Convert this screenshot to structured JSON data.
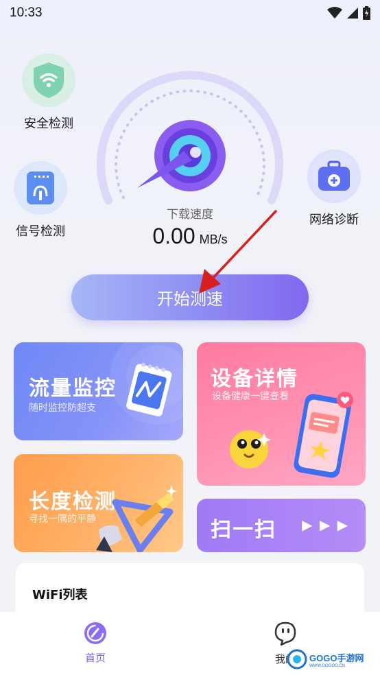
{
  "status_bar": {
    "time": "10:33"
  },
  "side_features": {
    "security": {
      "label": "安全检测",
      "icon": "shield-wifi-icon",
      "color": "#7fd3b1"
    },
    "signal": {
      "label": "信号检测",
      "icon": "router-icon",
      "color": "#5b8ef0"
    },
    "network": {
      "label": "网络诊断",
      "icon": "medical-kit-icon",
      "color": "#5b6ff0"
    }
  },
  "speed": {
    "label": "下载速度",
    "value": "0.00",
    "unit": "MB/s"
  },
  "start_button": {
    "label": "开始测速"
  },
  "cards": {
    "traffic": {
      "title": "流量监控",
      "subtitle": "随时监控防超支"
    },
    "device": {
      "title": "设备详情",
      "subtitle": "设备健康一键查看"
    },
    "length": {
      "title": "长度检测",
      "subtitle": "寻找一隅的平静"
    },
    "scan": {
      "title": "扫一扫",
      "arrows": "▶ ▶ ▶"
    }
  },
  "wifi_list": {
    "heading": "WiFi列表"
  },
  "bottom_nav": {
    "home": {
      "label": "首页",
      "color": "#7b5ff0"
    },
    "mine": {
      "label": "我的",
      "color": "#333333"
    }
  },
  "watermark": {
    "text": "GOGO手游网",
    "url": "WWW.GOGOO.CN"
  },
  "colors": {
    "accent": "#8367f0",
    "gauge": "#d9d6f7"
  }
}
